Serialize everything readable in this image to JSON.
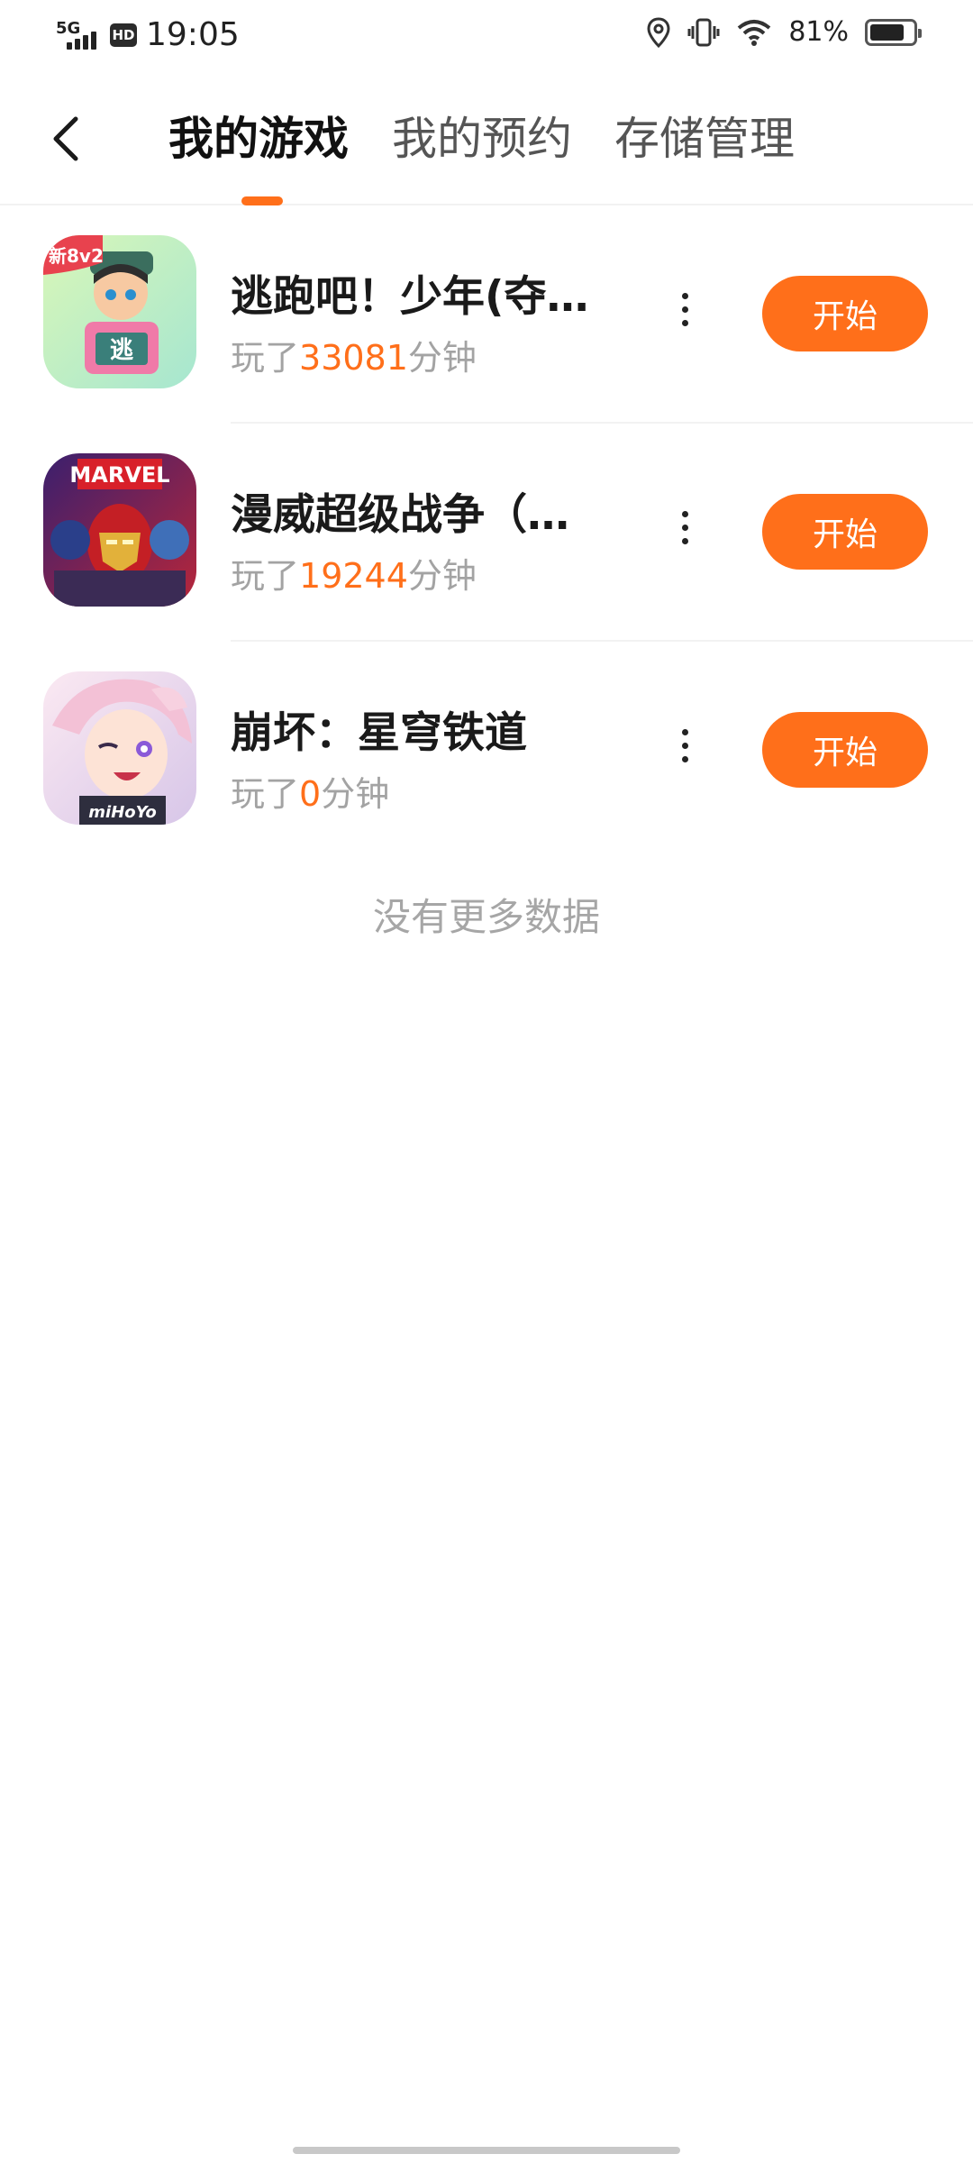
{
  "status_bar": {
    "network": "5G",
    "hd": "HD",
    "time": "19:05",
    "battery_percent": "81%",
    "battery_level": 0.81,
    "icons": [
      "location-icon",
      "vibrate-icon",
      "wifi-icon",
      "battery-icon"
    ]
  },
  "header": {
    "tabs": [
      {
        "label": "我的游戏",
        "active": true
      },
      {
        "label": "我的预约",
        "active": false
      },
      {
        "label": "存储管理",
        "active": false
      }
    ],
    "accent_color": "#ff6f1a"
  },
  "games": [
    {
      "name": "逃跑吧！少年(夺…",
      "played_prefix": "玩了",
      "minutes": "33081",
      "played_suffix": "分钟",
      "button": "开始",
      "icon_name": "game-icon-escape",
      "icon_badge": "新8v2",
      "icon_text": "逃"
    },
    {
      "name": "漫威超级战争（…",
      "played_prefix": "玩了",
      "minutes": "19244",
      "played_suffix": "分钟",
      "button": "开始",
      "icon_name": "game-icon-marvel",
      "icon_badge": "MARVEL"
    },
    {
      "name": "崩坏：星穹铁道",
      "played_prefix": "玩了",
      "minutes": "0",
      "played_suffix": "分钟",
      "button": "开始",
      "icon_name": "game-icon-starrail",
      "icon_badge": "miHoYo"
    }
  ],
  "footer_text": "没有更多数据"
}
